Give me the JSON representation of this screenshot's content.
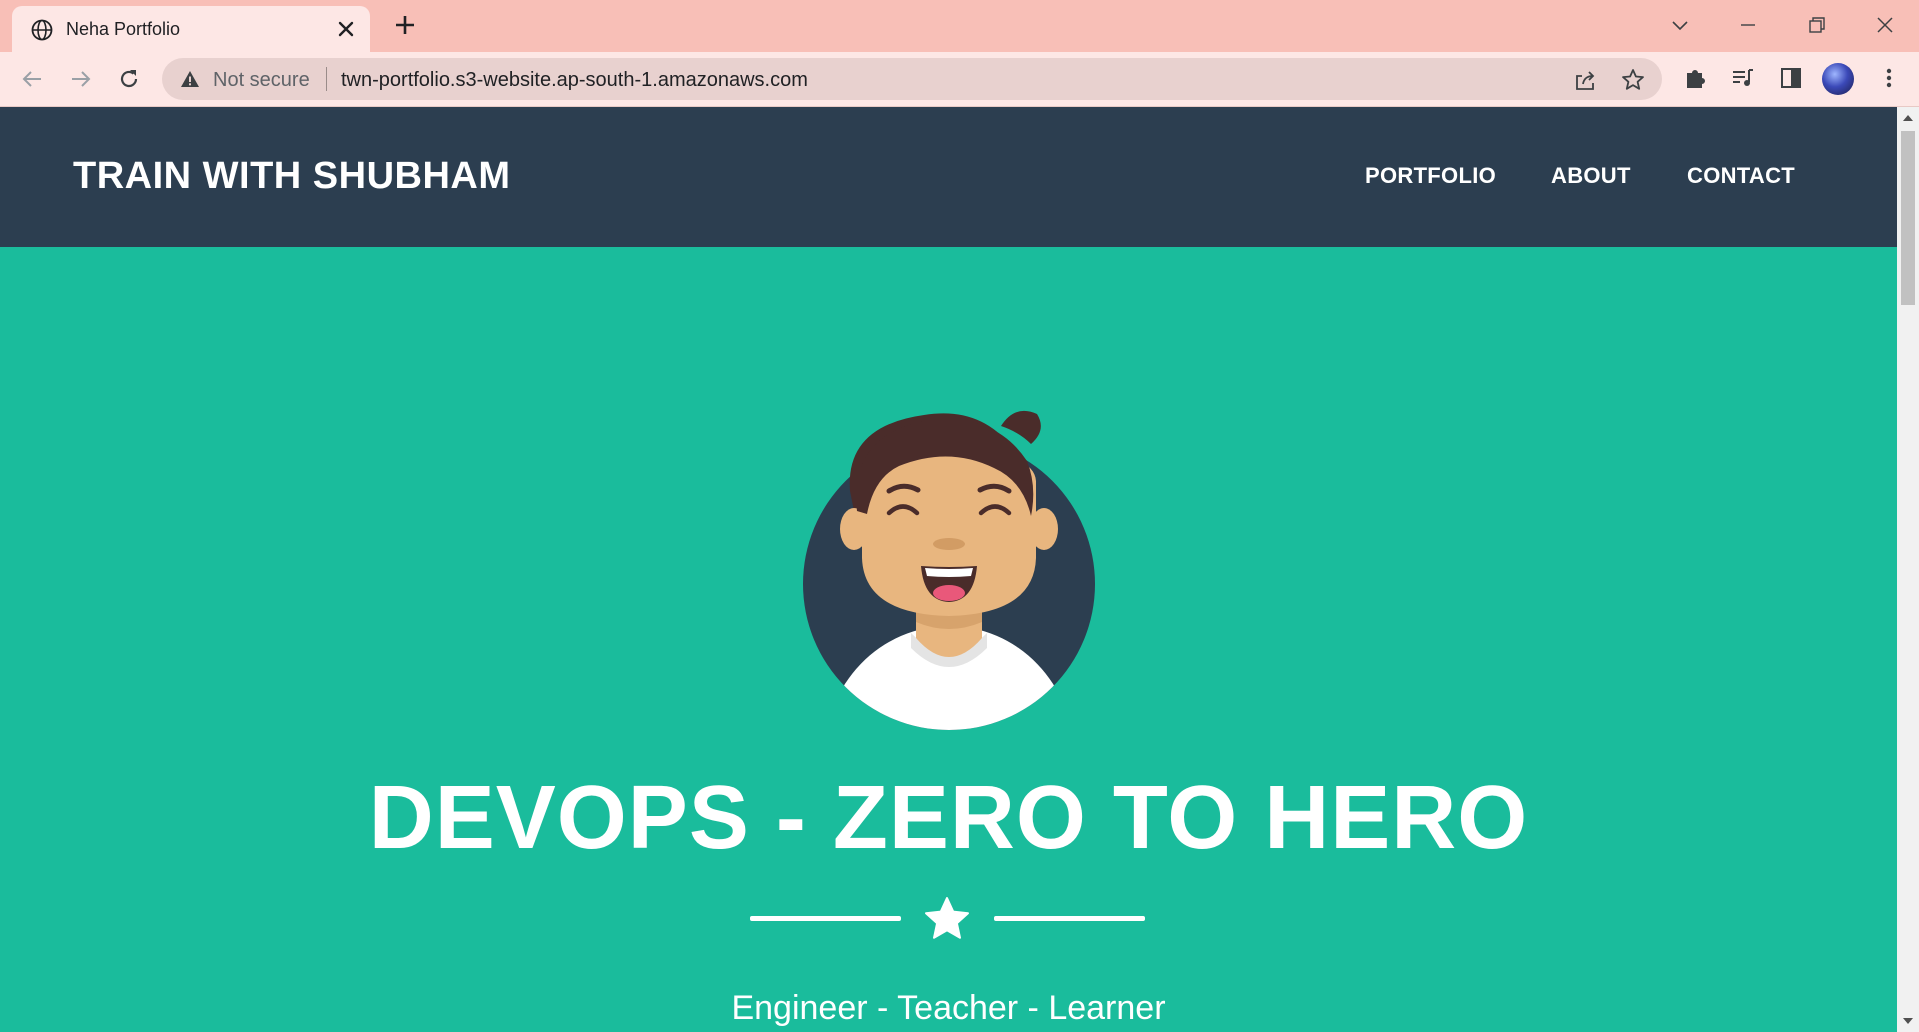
{
  "browser": {
    "tab_title": "Neha Portfolio",
    "security_label": "Not secure",
    "url": "twn-portfolio.s3-website.ap-south-1.amazonaws.com"
  },
  "site": {
    "brand": "TRAIN WITH SHUBHAM",
    "nav": [
      "PORTFOLIO",
      "ABOUT",
      "CONTACT"
    ]
  },
  "hero": {
    "title": "DEVOPS - ZERO TO HERO",
    "subtitle": "Engineer - Teacher - Learner"
  },
  "colors": {
    "navbar": "#2c3e50",
    "hero_background": "#1abc9c",
    "titlebar": "#f8bfb7",
    "toolbar": "#fde7e5"
  },
  "icons": {
    "tab": "globe-icon",
    "warning": "warning-icon",
    "divider": "star-icon"
  }
}
